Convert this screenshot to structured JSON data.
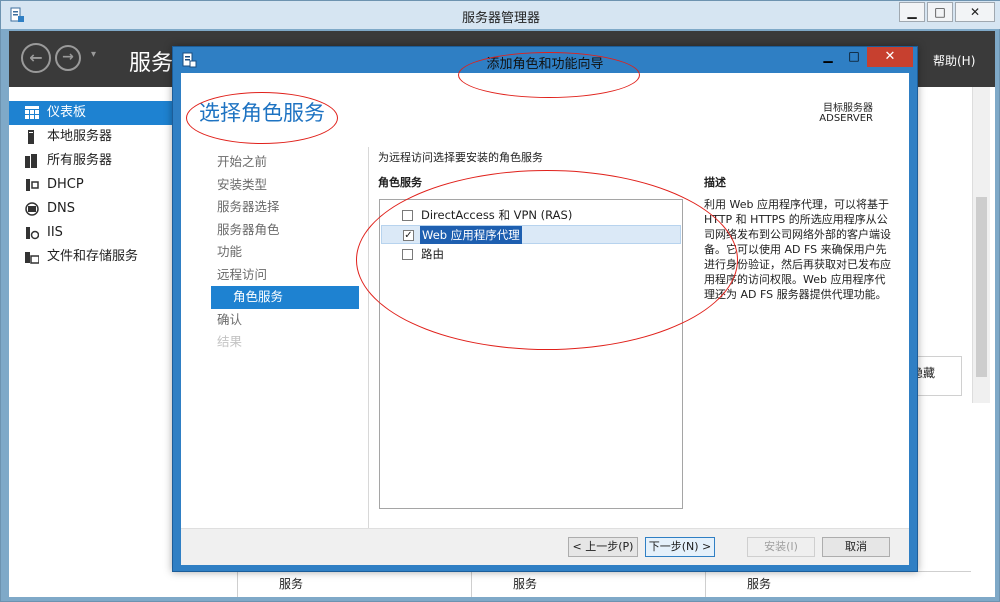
{
  "server_manager": {
    "title": "服务器管理器",
    "window_controls": {
      "minimize": "▁",
      "maximize": "□",
      "close": "✕"
    },
    "toolbar": {
      "back": "←",
      "forward": "→",
      "dropdown": "▾",
      "breadcrumb": "服务",
      "help": "帮助(H)"
    },
    "nav": [
      {
        "label": "仪表板",
        "icon": "dashboard-icon",
        "active": true
      },
      {
        "label": "本地服务器",
        "icon": "server-icon",
        "active": false
      },
      {
        "label": "所有服务器",
        "icon": "servers-icon",
        "active": false
      },
      {
        "label": "DHCP",
        "icon": "dhcp-icon",
        "active": false
      },
      {
        "label": "DNS",
        "icon": "dns-icon",
        "active": false
      },
      {
        "label": "IIS",
        "icon": "iis-icon",
        "active": false
      },
      {
        "label": "文件和存储服务",
        "icon": "storage-icon",
        "active": false
      }
    ],
    "hide_label": "隐藏",
    "bottom_columns": [
      "服务",
      "服务",
      "服务"
    ]
  },
  "wizard": {
    "title": "添加角色和功能向导",
    "window_controls": {
      "minimize": "▁",
      "maximize": "□",
      "close": "✕"
    },
    "heading": "选择角色服务",
    "target_server_label": "目标服务器",
    "target_server_name": "ADSERVER",
    "steps": [
      {
        "label": "开始之前",
        "state": "normal",
        "sub": false
      },
      {
        "label": "安装类型",
        "state": "normal",
        "sub": false
      },
      {
        "label": "服务器选择",
        "state": "normal",
        "sub": false
      },
      {
        "label": "服务器角色",
        "state": "normal",
        "sub": false
      },
      {
        "label": "功能",
        "state": "normal",
        "sub": false
      },
      {
        "label": "远程访问",
        "state": "normal",
        "sub": false
      },
      {
        "label": "角色服务",
        "state": "active",
        "sub": true
      },
      {
        "label": "确认",
        "state": "normal",
        "sub": false
      },
      {
        "label": "结果",
        "state": "disabled",
        "sub": false
      }
    ],
    "instruction": "为远程访问选择要安装的角色服务",
    "roles_label": "角色服务",
    "roles": [
      {
        "label": "DirectAccess 和 VPN (RAS)",
        "checked": false,
        "selected": false
      },
      {
        "label": "Web 应用程序代理",
        "checked": true,
        "selected": true
      },
      {
        "label": "路由",
        "checked": false,
        "selected": false
      }
    ],
    "description_label": "描述",
    "description": "利用 Web 应用程序代理，可以将基于 HTTP 和 HTTPS 的所选应用程序从公司网络发布到公司网络外部的客户端设备。它可以使用 AD FS 来确保用户先进行身份验证，然后再获取对已发布应用程序的访问权限。Web 应用程序代理还为 AD FS 服务器提供代理功能。",
    "buttons": {
      "previous": "< 上一步(P)",
      "next": "下一步(N) >",
      "install": "安装(I)",
      "cancel": "取消"
    }
  },
  "colors": {
    "accent": "#1e82d1",
    "wizard_frame": "#2f7fc4",
    "heading": "#1e73c2",
    "close": "#c7402f",
    "annotation": "#e0211b"
  }
}
